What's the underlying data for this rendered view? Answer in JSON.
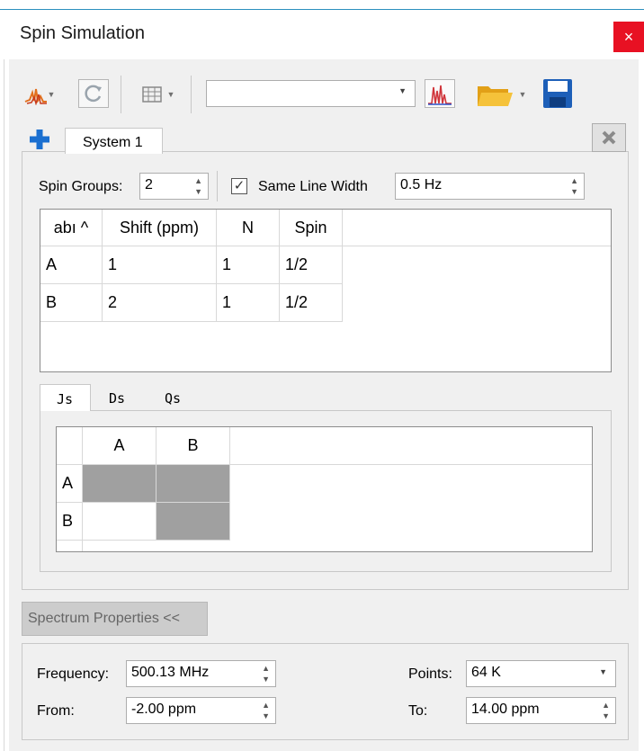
{
  "window": {
    "title": "Spin Simulation",
    "close_glyph": "×"
  },
  "toolbar": {
    "icons": [
      "spectrum-sim-icon",
      "refresh-icon",
      "table-icon",
      "multiplet-icon",
      "folder-open-icon",
      "save-icon"
    ],
    "dropdown_value": ""
  },
  "system_tab": {
    "label": "System 1"
  },
  "spin_groups": {
    "label": "Spin Groups:",
    "value": "2"
  },
  "same_line_width": {
    "label": "Same Line Width",
    "checked": true,
    "check_glyph": "✓",
    "value": "0.5 Hz"
  },
  "spin_table": {
    "headers": [
      "abı ^",
      "Shift (ppm)",
      "N",
      "Spin"
    ],
    "rows": [
      [
        "A",
        "1",
        "1",
        "1/2"
      ],
      [
        "B",
        "2",
        "1",
        "1/2"
      ]
    ]
  },
  "coupling_tabs": [
    "Js",
    "Ds",
    "Qs"
  ],
  "coupling_matrix": {
    "columns": [
      "A",
      "B"
    ],
    "rows": [
      "A",
      "B"
    ]
  },
  "spectrum_toggle": {
    "label": "Spectrum Properties <<"
  },
  "spectrum_properties": {
    "frequency_label": "Frequency:",
    "frequency_value": "500.13 MHz",
    "from_label": "From:",
    "from_value": "-2.00 ppm",
    "points_label": "Points:",
    "points_value": "64 K",
    "to_label": "To:",
    "to_value": "14.00 ppm"
  },
  "colors": {
    "accent": "#2b8fbe",
    "close": "#e81123",
    "plus": "#1a6fd0",
    "disk": "#1d5fb8",
    "folder": "#f2b21c",
    "disabled_cell": "#a0a0a0"
  }
}
